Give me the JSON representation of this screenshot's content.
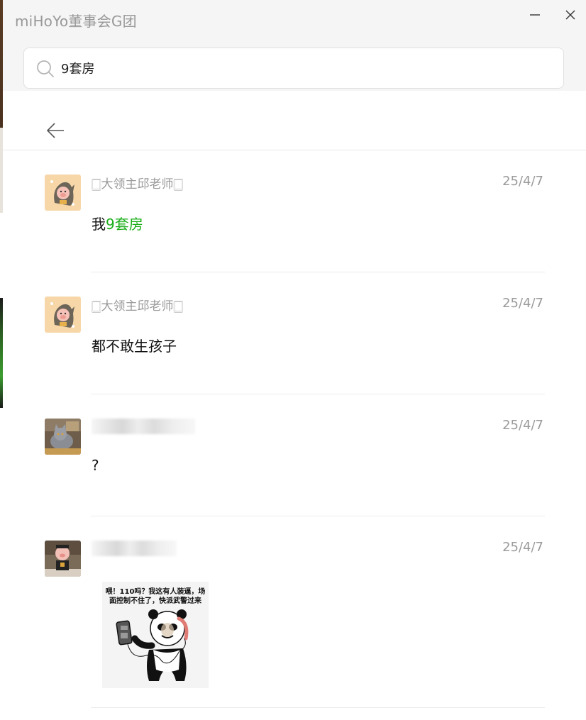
{
  "window": {
    "title": "miHoYo董事会G团"
  },
  "search": {
    "value": "9套房",
    "placeholder": ""
  },
  "results": [
    {
      "sender": "🀆大领主邱老师🀆",
      "date": "25/4/7",
      "text_before": "我",
      "text_highlight": "9套房",
      "avatar": "pig-in-hood-avatar"
    },
    {
      "sender": "🀆大领主邱老师🀆",
      "date": "25/4/7",
      "text": "都不敢生孩子",
      "avatar": "pig-in-hood-avatar"
    },
    {
      "sender_blurred": true,
      "date": "25/4/7",
      "text": "?",
      "avatar": "cat-photo-avatar"
    },
    {
      "sender_blurred": true,
      "date": "25/4/7",
      "sticker_text": "喂！110吗？我这有人装逼，场面控制不住了，快派武警过来",
      "avatar": "pig-figure-avatar"
    }
  ],
  "colors": {
    "highlight": "#1aad19",
    "titlebar_bg": "#f5f5f5",
    "muted_text": "#9a9a9a"
  }
}
